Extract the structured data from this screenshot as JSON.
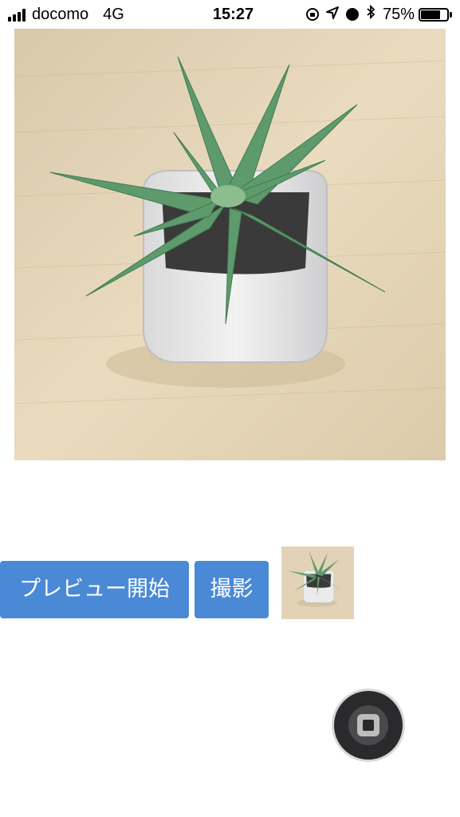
{
  "status_bar": {
    "carrier": "docomo",
    "network": "4G",
    "time": "15:27",
    "battery_percent": "75%",
    "battery_level": 0.75,
    "icons": [
      "signal-icon",
      "rotation-lock-icon",
      "location-icon",
      "alarm-icon",
      "bluetooth-icon",
      "battery-icon"
    ]
  },
  "preview": {
    "subject": "potted succulent plant"
  },
  "controls": {
    "preview_button_label": "プレビュー開始",
    "shoot_button_label": "撮影"
  },
  "colors": {
    "button_bg": "#4a89d6",
    "button_text": "#ffffff"
  }
}
